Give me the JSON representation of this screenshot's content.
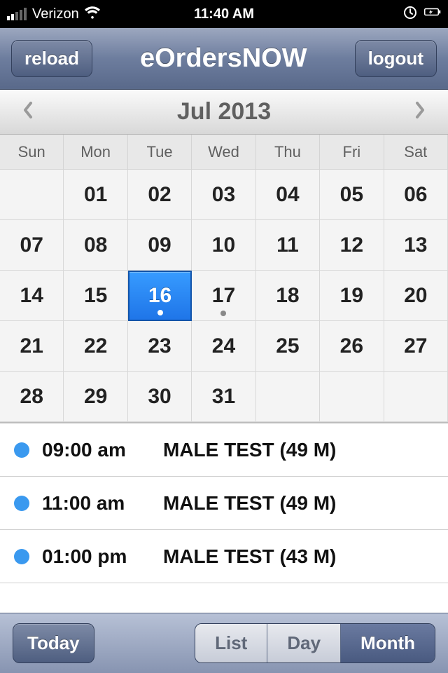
{
  "status_bar": {
    "carrier": "Verizon",
    "time": "11:40 AM"
  },
  "toolbar": {
    "reload_label": "reload",
    "title": "eOrdersNOW",
    "logout_label": "logout"
  },
  "month_header": {
    "title": "Jul 2013"
  },
  "dow": [
    "Sun",
    "Mon",
    "Tue",
    "Wed",
    "Thu",
    "Fri",
    "Sat"
  ],
  "calendar": {
    "leading_blanks": 1,
    "days": [
      "01",
      "02",
      "03",
      "04",
      "05",
      "06",
      "07",
      "08",
      "09",
      "10",
      "11",
      "12",
      "13",
      "14",
      "15",
      "16",
      "17",
      "18",
      "19",
      "20",
      "21",
      "22",
      "23",
      "24",
      "25",
      "26",
      "27",
      "28",
      "29",
      "30",
      "31"
    ],
    "selected_day": "16",
    "days_with_dots": [
      "16",
      "17"
    ]
  },
  "events": [
    {
      "time": "09:00 am",
      "title": "MALE TEST (49 M)"
    },
    {
      "time": "11:00 am",
      "title": "MALE TEST (49 M)"
    },
    {
      "time": "01:00 pm",
      "title": "MALE TEST (43 M)"
    }
  ],
  "bottom_bar": {
    "today_label": "Today",
    "segments": [
      "List",
      "Day",
      "Month"
    ],
    "active_segment": "Month"
  }
}
